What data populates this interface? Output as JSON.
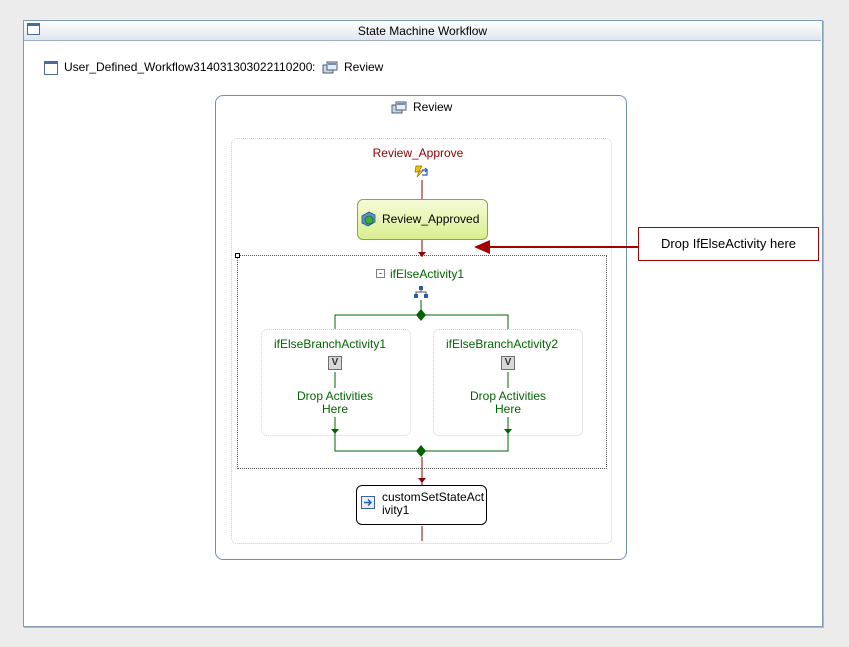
{
  "window": {
    "title": "State Machine Workflow"
  },
  "workflow": {
    "name": "User_Defined_Workflow314031303022110200",
    "separator": ":",
    "current_state": "Review"
  },
  "state": {
    "title": "Review",
    "event_driven": "Review_Approve",
    "first_activity": "Review_Approved",
    "ifelse": {
      "title": "ifElseActivity1",
      "branches": [
        {
          "title": "ifElseBranchActivity1",
          "drop_text": "Drop Activities\nHere"
        },
        {
          "title": "ifElseBranchActivity2",
          "drop_text": "Drop Activities\nHere"
        }
      ]
    },
    "set_state_activity": "customSetStateAct ivity1"
  },
  "callout": {
    "text": "Drop IfElseActivity here"
  },
  "colors": {
    "activity_green": "#006400",
    "event_red": "#8b0000",
    "callout_red": "#a40000",
    "state_border": "#6f8fb8"
  },
  "icons": {
    "window": "window-icon",
    "state": "state-icon",
    "event": "event-driven-icon",
    "activity": "activity-icon",
    "ifelse": "ifelse-icon",
    "branch_condition": "condition-v-icon",
    "set_state": "set-state-icon"
  }
}
